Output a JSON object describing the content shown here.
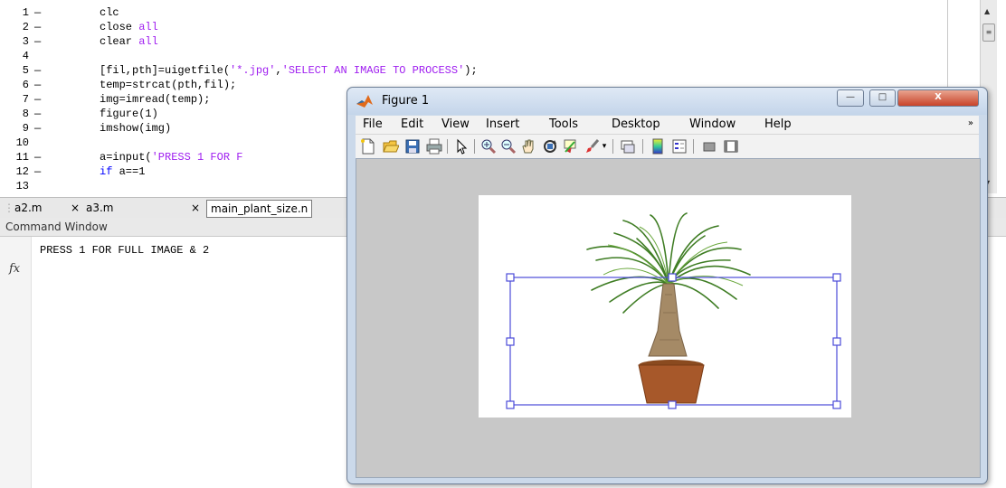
{
  "editor": {
    "line_numbers": [
      "1",
      "2",
      "3",
      "4",
      "5",
      "6",
      "7",
      "8",
      "9",
      "10",
      "11",
      "12",
      "13"
    ],
    "lines": [
      [
        [
          "clc",
          "t"
        ]
      ],
      [
        [
          "close ",
          "t"
        ],
        [
          "all",
          "s"
        ]
      ],
      [
        [
          "clear ",
          "t"
        ],
        [
          "all",
          "s"
        ]
      ],
      [],
      [
        [
          "[fil,pth]=uigetfile(",
          "t"
        ],
        [
          "'*.jpg'",
          "s"
        ],
        [
          ",",
          "t"
        ],
        [
          "'SELECT AN IMAGE TO PROCESS'",
          "s"
        ],
        [
          ");",
          "t"
        ]
      ],
      [
        [
          "temp=strcat(pth,fil);",
          "t"
        ]
      ],
      [
        [
          "img=imread(temp);",
          "t"
        ]
      ],
      [
        [
          "figure(1)",
          "t"
        ]
      ],
      [
        [
          "imshow(img)",
          "t"
        ]
      ],
      [],
      [
        [
          "a=input(",
          "t"
        ],
        [
          "'PRESS 1 FOR F",
          "s"
        ]
      ],
      [
        [
          "if ",
          "k"
        ],
        [
          "a==1",
          "t"
        ]
      ],
      []
    ]
  },
  "tabs": [
    {
      "label": "a2.m"
    },
    {
      "label": "a3.m"
    },
    {
      "label": "main_plant_size.n"
    }
  ],
  "tab_close_glyph": "×",
  "command_window": {
    "header": "Command Window",
    "prompt_symbol": "fx",
    "output": "PRESS 1 FOR FULL IMAGE & 2"
  },
  "figure": {
    "title": "Figure 1",
    "window_buttons": {
      "minimize": "—",
      "maximize": "□",
      "close": "X"
    },
    "menu": [
      "File",
      "Edit",
      "View",
      "Insert",
      "Tools",
      "Desktop",
      "Window",
      "Help"
    ],
    "menu_overflow": "»",
    "toolbar_icons": [
      "new-figure-icon",
      "open-file-icon",
      "save-icon",
      "print-icon",
      "edit-plot-arrow-icon",
      "zoom-in-icon",
      "zoom-out-icon",
      "pan-hand-icon",
      "rotate-3d-icon",
      "data-cursor-icon",
      "brush-icon",
      "brush-dropdown-icon",
      "link-plot-icon",
      "colorbar-icon",
      "legend-icon",
      "hide-plot-tools-icon",
      "show-plot-tools-icon"
    ],
    "image": {
      "content": "potted ponytail palm plant",
      "selection_rectangle_color": "#4b4bd8"
    }
  },
  "colors": {
    "string": "#a020f0",
    "keyword": "#0000ff",
    "window_frame": "#cbd9ea",
    "close_button": "#c8432a",
    "figure_background": "#c8c8c8"
  }
}
